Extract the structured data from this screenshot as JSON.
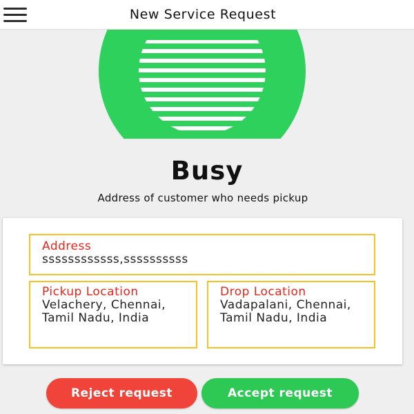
{
  "header": {
    "title": "New Service Request",
    "menu_icon": "hamburger-menu-icon"
  },
  "status": {
    "icon": "striped-circle-icon",
    "label": "Busy",
    "subtitle": "Address of customer who needs pickup"
  },
  "details": {
    "address": {
      "label": "Address",
      "value": "ssssssssssss,ssssssssss"
    },
    "pickup": {
      "label": "Pickup Location",
      "value": "Velachery, Chennai, Tamil Nadu, India"
    },
    "drop": {
      "label": "Drop Location",
      "value": "Vadapalani, Chennai, Tamil Nadu, India"
    }
  },
  "actions": {
    "reject_label": "Reject request",
    "accept_label": "Accept request"
  },
  "colors": {
    "accent_green": "#2ed15b",
    "reject_red": "#f0443a",
    "accept_green": "#2ec855",
    "label_red": "#e8251b",
    "border_yellow": "#f5c125"
  }
}
